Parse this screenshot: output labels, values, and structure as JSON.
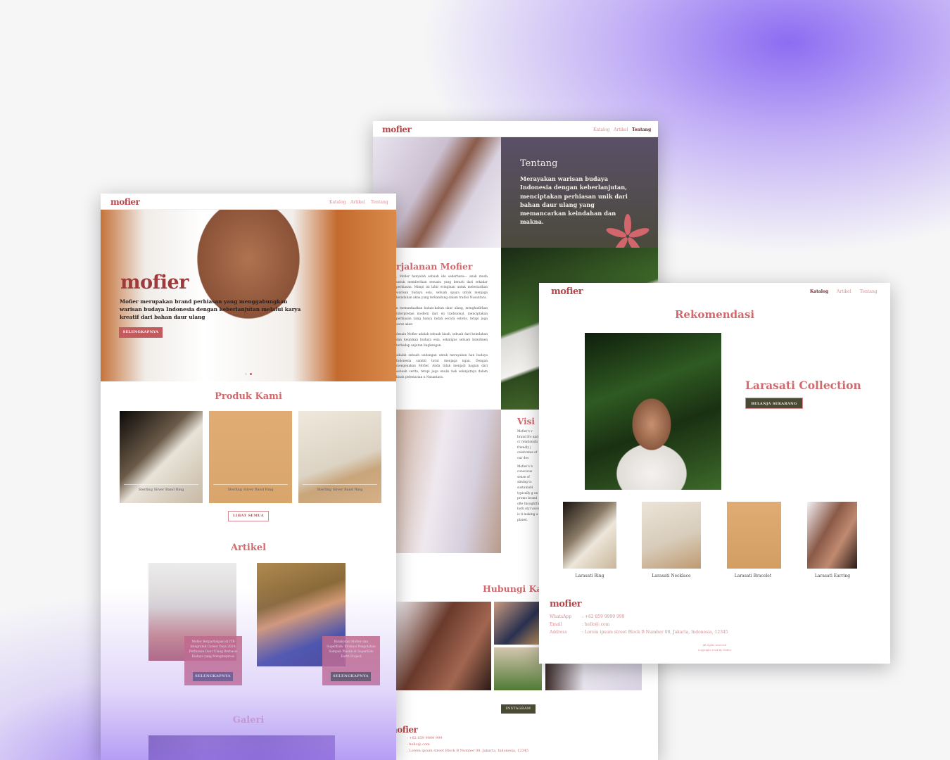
{
  "brand": "mofier",
  "nav": {
    "katalog": "Katalog",
    "artikel": "Artikel",
    "tentang": "Tentang"
  },
  "home": {
    "hero_text": "Mofier merupakan brand perhiasan yang menggabungkan warisan budaya Indonesia dengan keberlanjutan melalui karya kreatif dari bahan daur ulang",
    "hero_button": "SELENGKAPNYA",
    "products_title": "Produk Kami",
    "products": [
      "Sterling Silver Band Ring",
      "Sterling Silver Band Ring",
      "Sterling Silver Band Ring"
    ],
    "see_all": "LIHAT SEMUA",
    "articles_title": "Artikel",
    "articles": [
      {
        "title": "Mofier Berpartisipasi di ITB Integrated Career Days 2024: Perhiasan Daur Ulang Berbasis Budaya yang Menginspirasi",
        "button": "SELENGKAPNYA"
      },
      {
        "title": "Kolaborasi Mofier dan SuperKids: Edukasi Pengolahan Sampah Plastik di SuperKids Earth Project",
        "button": "SELENGKAPNYA"
      }
    ],
    "gallery_title": "Galeri"
  },
  "about": {
    "title": "Tentang",
    "text": "Merayakan warisan budaya Indonesia dengan keberlanjutan, menciptakan perhiasan unik dari bahan daur ulang yang memancarkan keindahan dan makna.",
    "journey_title": "rjalanan Mofier",
    "journey_paragraphs": [
      ", Mofier hanyalah sebuah ide sederhana— anak muda untuk memberikan sesuatu yang berarti dari sekadar perhiasan. Mimpi ini lahir eringinan untuk melestarikan warisan budaya esia, sebuah upaya untuk menjaga keindahan akna yang terkandung dalam tradisi Nusantara.",
      "n memanfaatkan bahan-bahan daur ulang, menghadirkan interpretasi modern dari en tradisional, menciptakan perhiasan yang hanya indah secara estetis, tetapi juga sarat akan",
      "desain Mofier adalah sebuah kisah, sebuah dari keindahan dan keunikan budaya esia, sekaligus sebuah komitmen terhadap anjutan lingkungan.",
      "adalah sebuah undangan untuk merayakan han budaya Indonesia sambil turut menjaga ngan. Dengan mengenakan Mofier, Anda tidak menjadi bagian dari sebuah cerita, tetapi juga enulis bab selanjutnya dalam kisah pelestarian n Nusantara."
    ],
    "vision_title": "Visi",
    "vision_paragraphs": [
      "Mofier's v brand fro and cr relationshi friendly j celebrates of our des",
      "Mofier's b conscious sense of aiming to sustainabl typically g on promo brand ofte thoughtful both styl voice is ti making a planet."
    ],
    "contact_title": "Hubungi Ka",
    "instagram": "INSTAGRAM"
  },
  "catalog": {
    "title": "Rekomendasi",
    "collection": "Larasati Collection",
    "shop_button": "BELANJA SEKARANG",
    "items": [
      "Larasati Ring",
      "Larasati Necklace",
      "Larasati Bracelet",
      "Larasati Earring"
    ]
  },
  "footer": {
    "whatsapp_label": "WhatsApp",
    "whatsapp": ": +62 859 9999 999",
    "email_label": "Email",
    "email": ": hello@.com",
    "address_label": "Address",
    "address": ": Lorem ipsum street Block B Number 08, Jakarta, Indonesia, 12345",
    "rights": "All rights reserved",
    "copyright": "Copyright 2024 By Mofier"
  },
  "colors": {
    "accent": "#cf6a6e",
    "dark": "#4a4a35",
    "brand": "#b8474c"
  }
}
